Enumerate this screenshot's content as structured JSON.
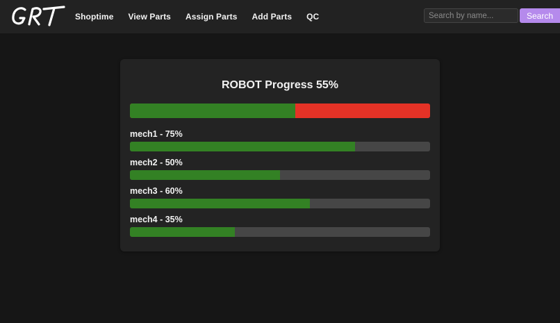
{
  "nav": {
    "logo_text": "GRT",
    "links": [
      "Shoptime",
      "View Parts",
      "Assign Parts",
      "Add Parts",
      "QC"
    ],
    "search_placeholder": "Search by name...",
    "search_button": "Search"
  },
  "robot": {
    "title": "ROBOT Progress 55%",
    "progress": 0.55,
    "complete_color": "#338124",
    "incomplete_color": "#e53226"
  },
  "mechs": [
    {
      "label": "mech1 - 75%",
      "progress": 0.75
    },
    {
      "label": "mech2 - 50%",
      "progress": 0.5
    },
    {
      "label": "mech3 - 60%",
      "progress": 0.6
    },
    {
      "label": "mech4 - 35%",
      "progress": 0.35
    }
  ],
  "colors": {
    "accent": "#b58aec",
    "track": "#464646",
    "fill": "#338124"
  }
}
